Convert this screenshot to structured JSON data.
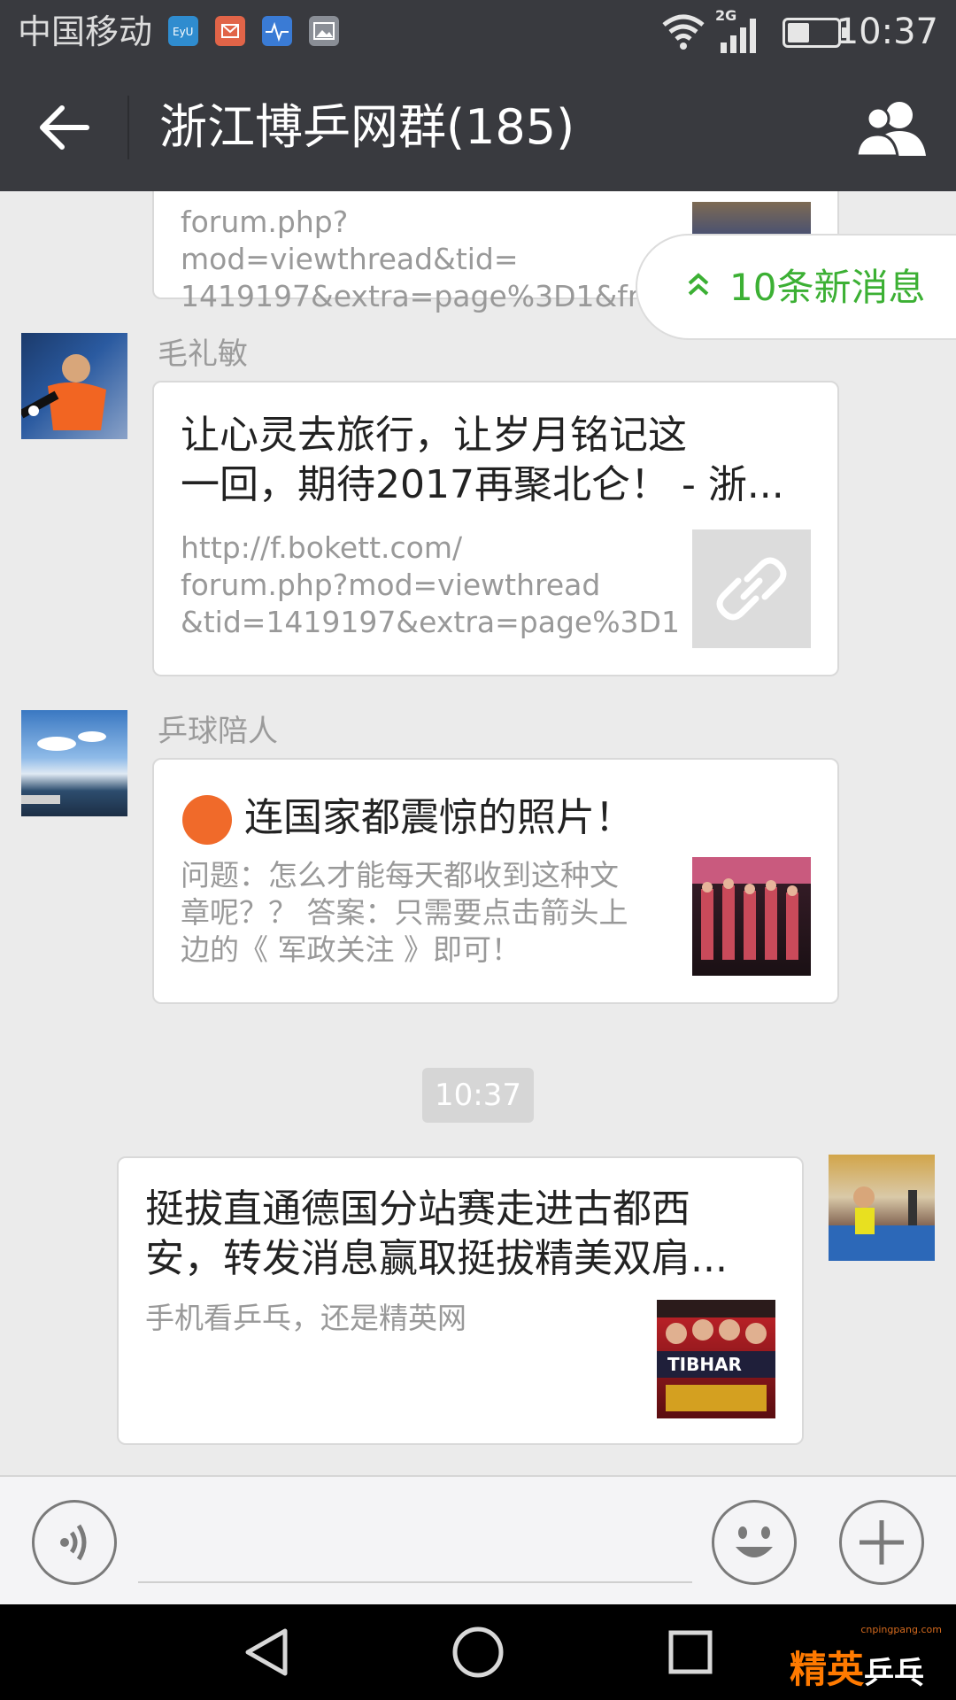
{
  "status_bar": {
    "carrier": "中国移动",
    "network": "2G",
    "time": "10:37",
    "notification_icons": [
      "eyu-app-icon",
      "mail-icon",
      "health-icon",
      "gallery-icon"
    ]
  },
  "header": {
    "title": "浙江博乒网群(185)",
    "back_icon": "back-arrow-icon",
    "members_icon": "group-members-icon"
  },
  "new_messages_badge": {
    "label": "10条新消息",
    "color": "#3cb034"
  },
  "messages": [
    {
      "partial": true,
      "desc": "forum.php?mod=viewthread&tid=\n1419197&extra=page%3D1&fro..."
    },
    {
      "sender": "毛礼敏",
      "title": "让心灵去旅行，让岁月铭记这\n一回，期待2017再聚北仑！ - 浙...",
      "desc": "http://f.bokett.com/\nforum.php?mod=viewthread\n&tid=1419197&extra=page%3D1",
      "thumb": "link-icon"
    },
    {
      "sender": "乒球陪人",
      "title": "连国家都震惊的照片！",
      "desc": "问题：怎么才能每天都收到这种文\n章呢？？ 答案：只需要点击箭头上\n边的《 军政关注 》即可！"
    },
    {
      "sender": "",
      "title": "挺拔直通德国分站赛走进古都西\n安，转发消息赢取挺拔精美双肩...",
      "desc": "手机看乒乓，还是精英网",
      "outgoing": true
    }
  ],
  "timestamp": "10:37",
  "input_bar": {
    "voice_icon": "voice-input-icon",
    "emoji_icon": "emoji-icon",
    "more_icon": "plus-icon"
  },
  "nav_bar": {
    "back": "nav-back-icon",
    "home": "nav-home-icon",
    "recents": "nav-recents-icon"
  },
  "watermark": {
    "url": "cnpingpang.com",
    "brand_a": "精英",
    "brand_b": "乒乓网"
  },
  "colors": {
    "header_bg": "#393a3f",
    "chat_bg": "#ebebeb",
    "accent_green": "#3cb034",
    "dot_orange": "#f06a2a"
  }
}
